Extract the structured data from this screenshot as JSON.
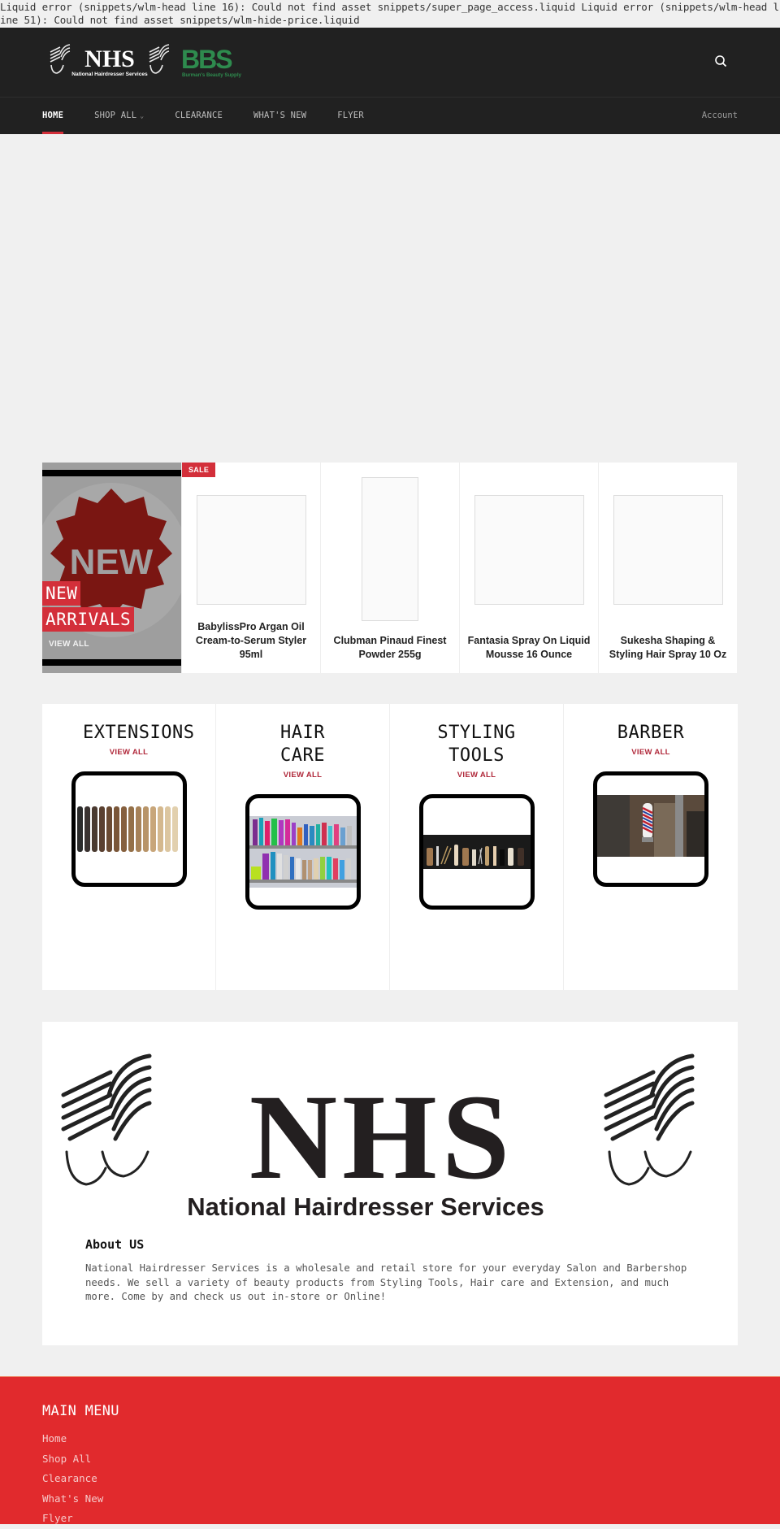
{
  "liquid_error": "Liquid error (snippets/wlm-head line 16): Could not find asset snippets/super_page_access.liquid Liquid error (snippets/wlm-head line 51): Could not find asset snippets/wlm-hide-price.liquid",
  "header": {
    "logo_primary": {
      "title": "NHS",
      "subtitle": "National Hairdresser Services"
    },
    "logo_secondary": {
      "title": "BBS",
      "subtitle": "Burman's Beauty Supply"
    },
    "search_icon": "search-icon"
  },
  "nav": {
    "items": [
      {
        "label": "HOME",
        "active": true
      },
      {
        "label": "SHOP ALL",
        "has_dropdown": true
      },
      {
        "label": "CLEARANCE"
      },
      {
        "label": "WHAT'S NEW"
      },
      {
        "label": "FLYER"
      }
    ],
    "account": "Account"
  },
  "new_arrivals": {
    "image_text": "NEW",
    "title_line1": "NEW",
    "title_line2": "ARRIVALS",
    "view_all": "VIEW ALL"
  },
  "products": [
    {
      "name": "BabylissPro Argan Oil Cream-to-Serum Styler 95ml",
      "badge": "SALE"
    },
    {
      "name": "Clubman Pinaud Finest Powder 255g"
    },
    {
      "name": "Fantasia Spray On Liquid Mousse 16 Ounce"
    },
    {
      "name": "Sukesha Shaping & Styling Hair Spray 10 Oz"
    }
  ],
  "categories": [
    {
      "title": "EXTENSIONS",
      "view_all": "VIEW ALL"
    },
    {
      "title": "HAIR CARE",
      "view_all": "VIEW ALL"
    },
    {
      "title": "STYLING TOOLS",
      "view_all": "VIEW ALL"
    },
    {
      "title": "BARBER",
      "view_all": "VIEW ALL"
    }
  ],
  "about": {
    "logo_title": "NHS",
    "logo_subtitle": "National Hairdresser Services",
    "heading": "About US",
    "body": "National Hairdresser Services is a wholesale and retail store for your everyday Salon and Barbershop needs. We sell a variety of beauty products from Styling Tools, Hair care and Extension, and much more. Come by and check us out in-store or Online!"
  },
  "footer": {
    "heading": "MAIN MENU",
    "links": [
      "Home",
      "Shop All",
      "Clearance",
      "What's New",
      "Flyer"
    ]
  },
  "colors": {
    "header_bg": "#212121",
    "accent_red": "#d32f3a",
    "footer_red": "#e12a2d",
    "bbs_green": "#2e8b4e",
    "page_bg": "#f0f0f0"
  }
}
